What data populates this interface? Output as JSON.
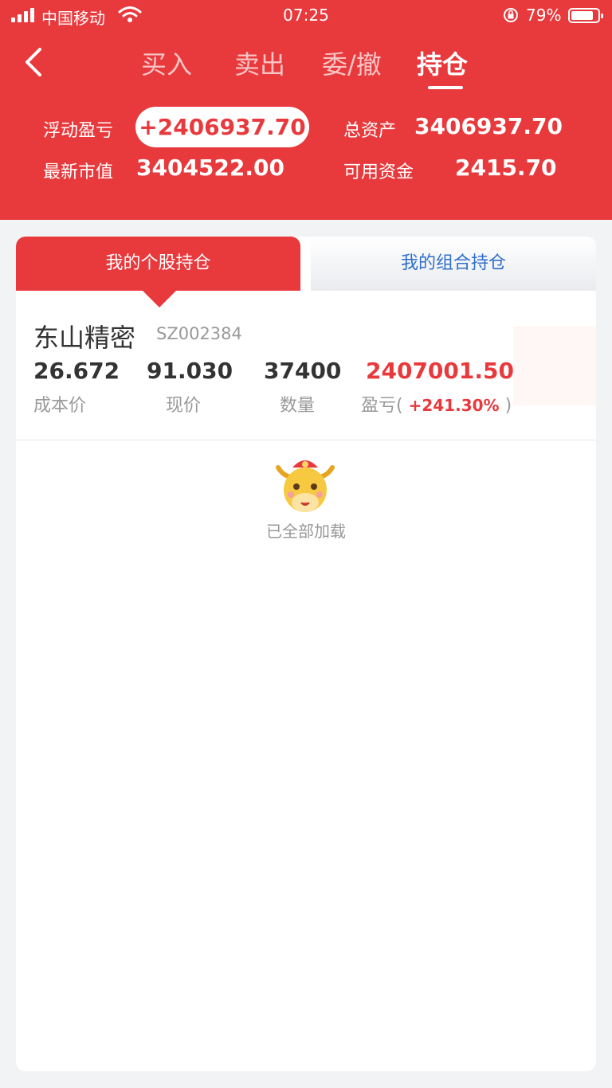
{
  "status_bar": {
    "carrier": "中国移动",
    "time": "07:25",
    "battery": "79%",
    "battery_level": 0.79
  },
  "nav": {
    "back_icon": "chevron-left-icon",
    "tabs": [
      {
        "label": "买入",
        "active": false
      },
      {
        "label": "卖出",
        "active": false
      },
      {
        "label": "委/撤",
        "active": false
      },
      {
        "label": "持仓",
        "active": true
      }
    ]
  },
  "summary": {
    "floating_pnl_label": "浮动盈亏",
    "floating_pnl_value": "+2406937.70",
    "total_assets_label": "总资产",
    "total_assets_value": "3406937.70",
    "market_value_label": "最新市值",
    "market_value_value": "3404522.00",
    "available_funds_label": "可用资金",
    "available_funds_value": "2415.70"
  },
  "segments": {
    "stock_holdings": "我的个股持仓",
    "portfolio_holdings": "我的组合持仓"
  },
  "holdings": [
    {
      "name": "东山精密",
      "code": "SZ002384",
      "cost_price": "26.672",
      "cost_price_label": "成本价",
      "current_price": "91.030",
      "current_price_label": "现价",
      "quantity": "37400",
      "quantity_label": "数量",
      "pnl": "2407001.50",
      "pnl_label": "盈亏(",
      "pnl_pct": "+241.30%",
      "pnl_close": ")"
    }
  ],
  "footer": {
    "mascot_icon": "ox-mascot-icon",
    "loaded_text": "已全部加载"
  },
  "colors": {
    "primary_red": "#e8393c",
    "link_blue": "#2f6fc9"
  }
}
